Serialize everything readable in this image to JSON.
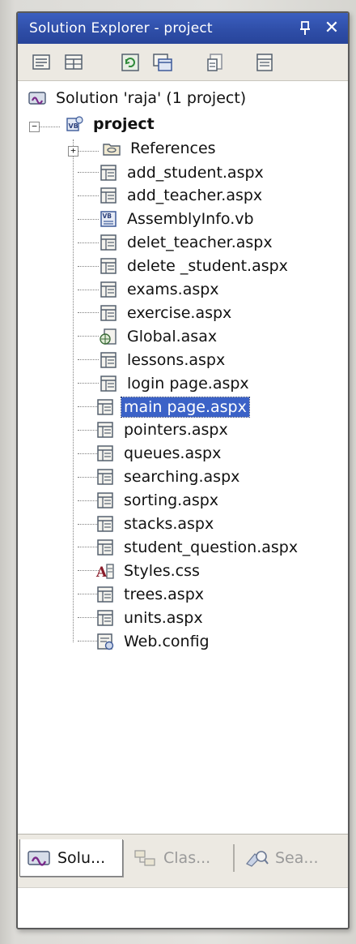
{
  "window": {
    "title": "Solution Explorer - project",
    "pin_icon": "pin-icon",
    "close_glyph": "✕"
  },
  "toolbar": {
    "buttons": [
      {
        "name": "properties-button",
        "icon": "properties-icon"
      },
      {
        "name": "show-all-files-button",
        "icon": "show-all-files-icon"
      },
      {
        "name": "refresh-button",
        "icon": "refresh-icon"
      },
      {
        "name": "view-designer-button",
        "icon": "view-designer-icon"
      },
      {
        "name": "view-code-button",
        "icon": "view-code-icon"
      },
      {
        "name": "copy-web-button",
        "icon": "copy-web-icon"
      }
    ]
  },
  "tree": {
    "solution": {
      "label": "Solution 'raja' (1 project)",
      "icon": "solution-icon"
    },
    "project": {
      "label": "project",
      "icon": "vb-project-icon",
      "expander": "−"
    },
    "references": {
      "label": "References",
      "icon": "references-folder-icon",
      "expander": "+"
    },
    "items": [
      {
        "label": "add_student.aspx",
        "icon": "aspx-file-icon"
      },
      {
        "label": "add_teacher.aspx",
        "icon": "aspx-file-icon"
      },
      {
        "label": "AssemblyInfo.vb",
        "icon": "vb-file-icon"
      },
      {
        "label": "delet_teacher.aspx",
        "icon": "aspx-file-icon"
      },
      {
        "label": "delete _student.aspx",
        "icon": "aspx-file-icon"
      },
      {
        "label": "exams.aspx",
        "icon": "aspx-file-icon"
      },
      {
        "label": "exercise.aspx",
        "icon": "aspx-file-icon"
      },
      {
        "label": "Global.asax",
        "icon": "global-asax-icon"
      },
      {
        "label": "lessons.aspx",
        "icon": "aspx-file-icon"
      },
      {
        "label": "login page.aspx",
        "icon": "aspx-file-icon"
      },
      {
        "label": "main page.aspx",
        "icon": "aspx-file-icon",
        "selected": true
      },
      {
        "label": "pointers.aspx",
        "icon": "aspx-file-icon"
      },
      {
        "label": "queues.aspx",
        "icon": "aspx-file-icon"
      },
      {
        "label": "searching.aspx",
        "icon": "aspx-file-icon"
      },
      {
        "label": "sorting.aspx",
        "icon": "aspx-file-icon"
      },
      {
        "label": "stacks.aspx",
        "icon": "aspx-file-icon"
      },
      {
        "label": "student_question.aspx",
        "icon": "aspx-file-icon"
      },
      {
        "label": "Styles.css",
        "icon": "css-file-icon"
      },
      {
        "label": "trees.aspx",
        "icon": "aspx-file-icon"
      },
      {
        "label": "units.aspx",
        "icon": "aspx-file-icon"
      },
      {
        "label": "Web.config",
        "icon": "config-file-icon"
      }
    ]
  },
  "tabs": [
    {
      "label": "Solu...",
      "icon": "solution-explorer-icon",
      "active": true
    },
    {
      "label": "Clas...",
      "icon": "class-view-icon",
      "active": false
    },
    {
      "label": "Sea...",
      "icon": "search-icon",
      "active": false
    }
  ],
  "colors": {
    "title_bar": "#2f4ea8",
    "selection": "#3b62c7",
    "toolbar": "#ece9e2"
  }
}
